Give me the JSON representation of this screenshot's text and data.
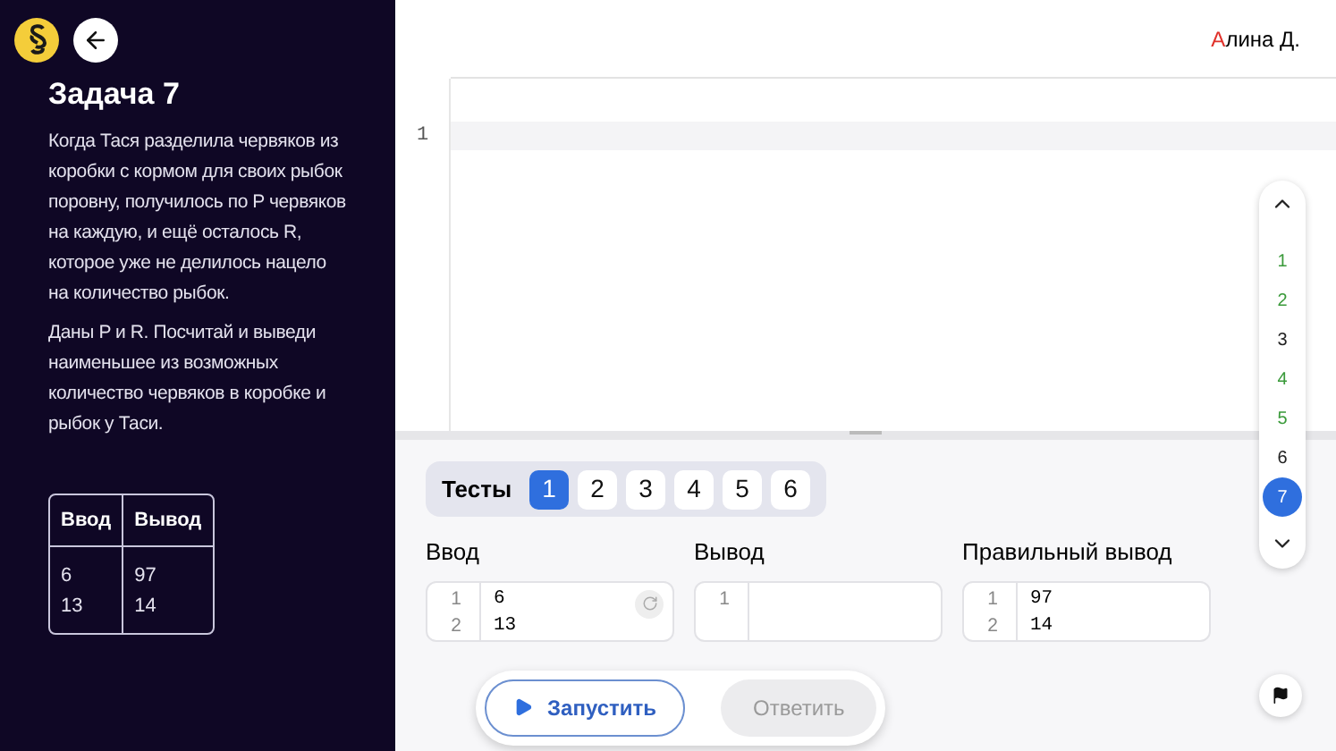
{
  "header": {
    "user": "Алина Д."
  },
  "task": {
    "title": "Задача 7",
    "paragraphs": [
      "Когда Тася разделила червяков из коробки с кормом для своих рыбок поровну, получилось по P червяков на каждую, и ещё осталось R, которое уже не делилось нацело на количество рыбок.",
      "Даны P и R. Посчитай и выведи наименьшее из возможных количество червяков в коробке и рыбок у Таси."
    ],
    "example": {
      "columns": [
        "Ввод",
        "Вывод"
      ],
      "cells": [
        [
          "6\n13",
          "97\n14"
        ]
      ]
    }
  },
  "editor": {
    "lines": [
      "1"
    ]
  },
  "tests": {
    "label": "Тесты",
    "items": [
      {
        "label": "1",
        "selected": true
      },
      {
        "label": "2",
        "selected": false
      },
      {
        "label": "3",
        "selected": false
      },
      {
        "label": "4",
        "selected": false
      },
      {
        "label": "5",
        "selected": false
      },
      {
        "label": "6",
        "selected": false
      }
    ]
  },
  "panes": [
    {
      "label": "Ввод",
      "lines": [
        {
          "n": "1",
          "text": "6"
        },
        {
          "n": "2",
          "text": "13"
        }
      ],
      "reset": true
    },
    {
      "label": "Вывод",
      "lines": [
        {
          "n": "1"
        }
      ],
      "reset": false
    },
    {
      "label": "Правильный вывод",
      "lines": [
        {
          "n": "1",
          "text": "97"
        },
        {
          "n": "2",
          "text": "14"
        }
      ],
      "reset": false
    }
  ],
  "actions": {
    "run": "Запустить",
    "answer": "Ответить",
    "answer_disabled": true
  },
  "task_nav": [
    {
      "label": "1",
      "solved": true,
      "selected": false
    },
    {
      "label": "2",
      "solved": true,
      "selected": false
    },
    {
      "label": "3",
      "solved": false,
      "selected": false
    },
    {
      "label": "4",
      "solved": true,
      "selected": false
    },
    {
      "label": "5",
      "solved": true,
      "selected": false
    },
    {
      "label": "6",
      "solved": false,
      "selected": false
    },
    {
      "label": "7",
      "solved": false,
      "selected": true
    }
  ]
}
